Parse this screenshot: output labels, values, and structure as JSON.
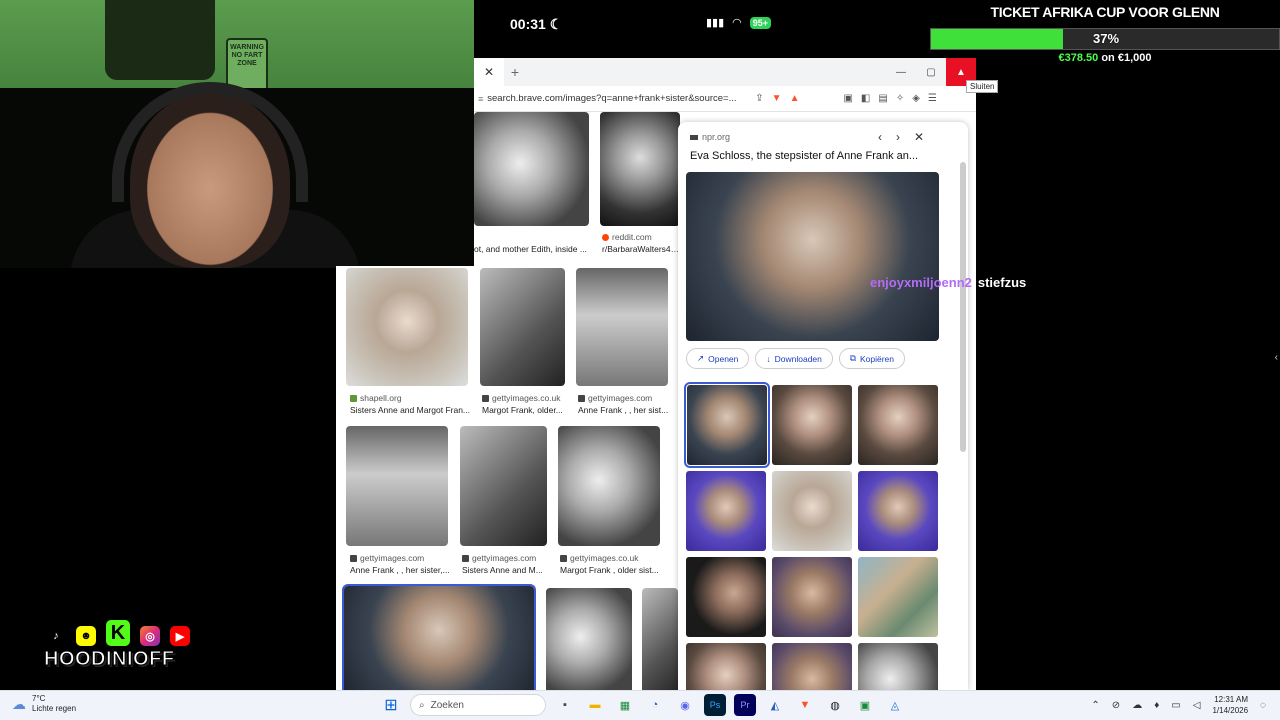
{
  "phone": {
    "time": "00:31",
    "battery": "95+"
  },
  "goal": {
    "title": "TICKET AFRIKA CUP VOOR GLENN",
    "percent_label": "37%",
    "fraction": 0.378,
    "raised": "€378.50",
    "of": "on",
    "target": "€1,000"
  },
  "browser": {
    "tab_close": "✕",
    "tab_add": "+",
    "url": "search.brave.com/images?q=anne+frank+sister&source=...",
    "close_tooltip": "Sluiten"
  },
  "results": {
    "top": [
      {
        "title": "ot, and mother Edith, inside ..."
      },
      {
        "source": "reddit.com",
        "title": "r/BarbaraWalters4S..."
      }
    ],
    "row1": [
      {
        "source": "shapell.org",
        "title": "Sisters Anne and Margot Fran..."
      },
      {
        "source": "gettyimages.co.uk",
        "title": "Margot Frank, older..."
      },
      {
        "source": "gettyimages.com",
        "title": "Anne Frank , , her sist..."
      }
    ],
    "row2": [
      {
        "source": "gettyimages.com",
        "title": "Anne Frank , , her sister,..."
      },
      {
        "source": "gettyimages.com",
        "title": "Sisters Anne and M..."
      },
      {
        "source": "gettyimages.co.uk",
        "title": "Margot Frank , older sist..."
      }
    ]
  },
  "preview": {
    "source": "npr.org",
    "title": "Eva Schloss, the stepsister of Anne Frank an...",
    "actions": {
      "open": "Openen",
      "download": "Downloaden",
      "copy": "Kopiëren"
    }
  },
  "chat": {
    "user": "enjoyxmiljoenn2",
    "message": "stiefzus"
  },
  "stream": {
    "handle": "HOODINIOFF"
  },
  "taskbar": {
    "weather_temp": "7°C",
    "weather_desc": "Lichte regen",
    "search_placeholder": "Zoeken",
    "time": "12:31 AM",
    "date": "1/14/2026"
  },
  "colors": {
    "goal_fill": "#3fe03a",
    "chat_user": "#b36bf5",
    "close_red": "#e81123",
    "link_blue": "#1a3fbf"
  }
}
